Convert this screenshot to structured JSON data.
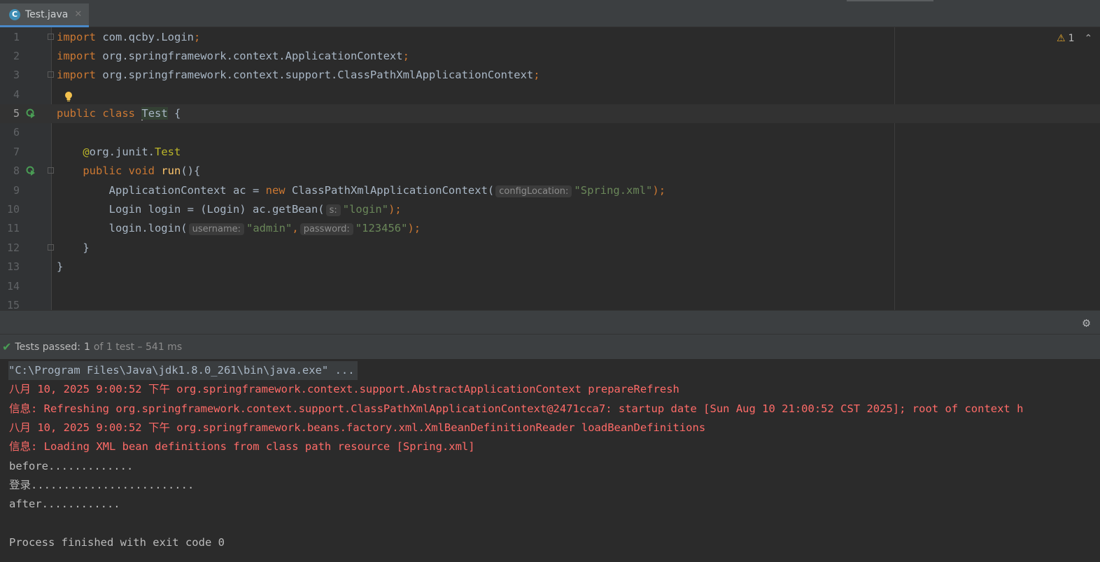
{
  "tab": {
    "label": "Test.java",
    "icon": "C",
    "close": "✕"
  },
  "editor": {
    "line_numbers": [
      "1",
      "2",
      "3",
      "4",
      "5",
      "6",
      "7",
      "8",
      "9",
      "10",
      "11",
      "12",
      "13",
      "14",
      "15"
    ],
    "warnings": {
      "count": "1"
    },
    "code": {
      "l1": {
        "kw": "import",
        "rest": " com.qcby.Login",
        "semi": ";"
      },
      "l2": {
        "kw": "import",
        "rest": " org.springframework.context.ApplicationContext",
        "semi": ";"
      },
      "l3": {
        "kw": "import",
        "rest": " org.springframework.context.support.ClassPathXmlApplicationContext",
        "semi": ";"
      },
      "l5": {
        "kw1": "public",
        "kw2": "class",
        "name": "Test",
        "brace": " {"
      },
      "l7": {
        "ann_at": "@",
        "ann_pkg": "org.junit.",
        "ann_name": "Test"
      },
      "l8": {
        "kw1": "public",
        "kw2": "void",
        "fn": "run",
        "rest": "(){"
      },
      "l9": {
        "type": "ApplicationContext ac = ",
        "kw": "new",
        "cls": " ClassPathXmlApplicationContext(",
        "hint": "configLocation:",
        "str": "\"Spring.xml\"",
        "end": ");"
      },
      "l10": {
        "pre": "Login login = (Login) ac.getBean(",
        "hint": "s:",
        "str": "\"login\"",
        "end": ");"
      },
      "l11": {
        "pre": "login.login(",
        "hint1": "username:",
        "str1": "\"admin\"",
        "comma": ",",
        "hint2": "password:",
        "str2": "\"123456\"",
        "end": ");"
      },
      "l12": {
        "text": "}"
      },
      "l13": {
        "text": "}"
      }
    }
  },
  "test_status": {
    "label": "Tests passed:",
    "count": "1",
    "detail": "of 1 test – 541 ms"
  },
  "console": {
    "lines": [
      "\"C:\\Program Files\\Java\\jdk1.8.0_261\\bin\\java.exe\" ...",
      "八月 10, 2025 9:00:52 下午 org.springframework.context.support.AbstractApplicationContext prepareRefresh",
      "信息: Refreshing org.springframework.context.support.ClassPathXmlApplicationContext@2471cca7: startup date [Sun Aug 10 21:00:52 CST 2025]; root of context h",
      "八月 10, 2025 9:00:52 下午 org.springframework.beans.factory.xml.XmlBeanDefinitionReader loadBeanDefinitions",
      "信息: Loading XML bean definitions from class path resource [Spring.xml]",
      "before.............",
      "登录.........................",
      "after............",
      "",
      "Process finished with exit code 0"
    ]
  },
  "colors": {
    "keyword": "#cc7832",
    "string": "#6a8759",
    "annotation": "#bbb529",
    "function": "#ffc66d",
    "error": "#ff6b68",
    "pass": "#499c54"
  }
}
